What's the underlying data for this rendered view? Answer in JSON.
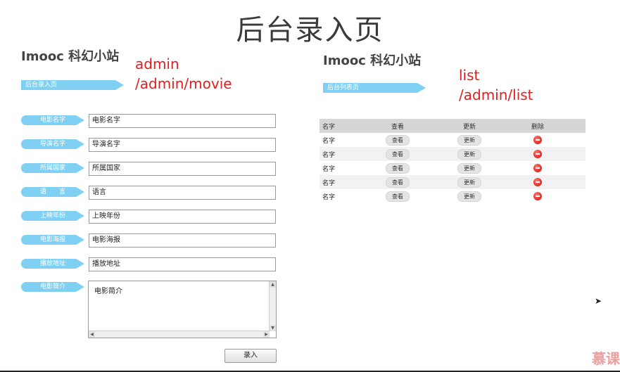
{
  "slide_title": "后台录入页",
  "left": {
    "brand": "Imooc 科幻小站",
    "section_tag": "后台录入页",
    "annotation_line1": "admin",
    "annotation_line2": "/admin/movie",
    "fields": [
      {
        "label": "电影名字",
        "value": "电影名字"
      },
      {
        "label": "导演名字",
        "value": "导演名字"
      },
      {
        "label": "所属国家",
        "value": "所属国家"
      },
      {
        "label": "语　　言",
        "value": "语言"
      },
      {
        "label": "上映年份",
        "value": "上映年份"
      },
      {
        "label": "电影海报",
        "value": "电影海报"
      },
      {
        "label": "播放地址",
        "value": "播放地址"
      }
    ],
    "summary_label": "电影简介",
    "summary_value": "电影简介",
    "submit_label": "录入"
  },
  "right": {
    "brand": "Imooc 科幻小站",
    "section_tag": "后台列表页",
    "annotation_line1": "list",
    "annotation_line2": "/admin/list",
    "table_headers": [
      "名字",
      "查看",
      "更新",
      "删除"
    ],
    "rows": [
      {
        "name": "名字",
        "view": "查看",
        "update": "更新"
      },
      {
        "name": "名字",
        "view": "查看",
        "update": "更新"
      },
      {
        "name": "名字",
        "view": "查看",
        "update": "更新"
      },
      {
        "name": "名字",
        "view": "查看",
        "update": "更新"
      },
      {
        "name": "名字",
        "view": "查看",
        "update": "更新"
      }
    ]
  },
  "logo_text": "慕课"
}
